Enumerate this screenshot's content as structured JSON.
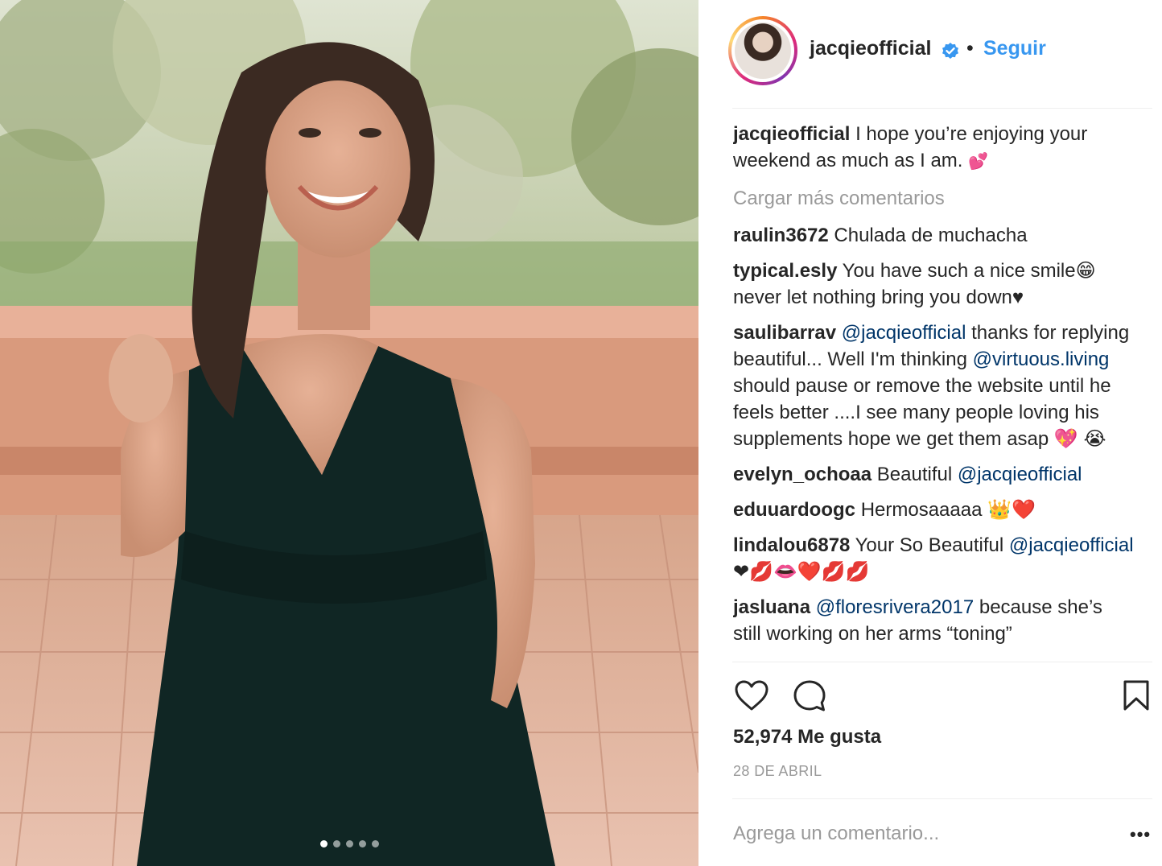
{
  "photo": {
    "alt": "Woman in a dark green halter dress smiling on a terrace",
    "carousel_dots": 5,
    "active_dot": 0
  },
  "header": {
    "username": "jacqieofficial",
    "separator": "•",
    "follow_label": "Seguir"
  },
  "caption": {
    "user": "jacqieofficial",
    "text": "I hope you’re enjoying your weekend as much as I am.",
    "emoji": "💕"
  },
  "load_more": "Cargar más comentarios",
  "comments": [
    {
      "user": "raulin3672",
      "text": "Chulada de muchacha"
    },
    {
      "user": "typical.esly",
      "text": "You have such a nice smile😁 never let nothing bring you down♥"
    },
    {
      "user": "saulibarrav",
      "mention1": "@jacqieofficial",
      "text1": "thanks for replying beautiful... Well I'm thinking",
      "mention2": "@virtuous.living",
      "text2": "should pause or remove the website until he feels better ....I see many people loving his supplements hope we get them asap 💖 😭"
    },
    {
      "user": "evelyn_ochoaa",
      "text": "Beautiful",
      "mention": "@jacqieofficial"
    },
    {
      "user": "eduuardoogc",
      "text": "Hermosaaaaa 👑❤️"
    },
    {
      "user": "lindalou6878",
      "text": "Your So Beautiful",
      "mention": "@jacqieofficial",
      "tail": "❤💋👄❤️💋💋"
    },
    {
      "user": "jasluana",
      "mention": "@floresrivera2017",
      "text": "because she’s still working on her arms “toning”"
    }
  ],
  "likes": "52,974 Me gusta",
  "date": "28 DE ABRIL",
  "add_comment_placeholder": "Agrega un comentario...",
  "more_label": "•••",
  "colors": {
    "link_blue": "#3897f0",
    "mention_blue": "#003569",
    "muted_gray": "#999999",
    "text": "#262626"
  },
  "icons": [
    "heart-icon",
    "comment-icon",
    "bookmark-icon",
    "verified-badge-icon"
  ]
}
